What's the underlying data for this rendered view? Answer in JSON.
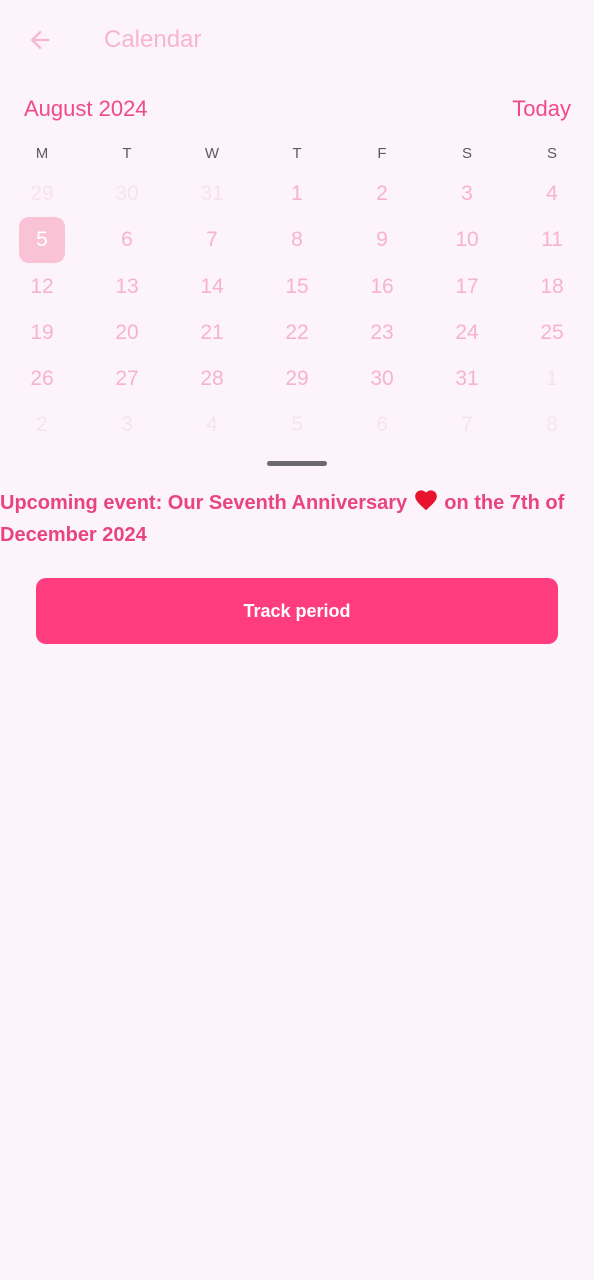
{
  "appbar": {
    "title": "Calendar",
    "back_icon": "arrow-left-icon"
  },
  "calendar": {
    "month_label": "August 2024",
    "today_label": "Today",
    "weekdays": [
      "M",
      "T",
      "W",
      "T",
      "F",
      "S",
      "S"
    ],
    "selected_day": "5",
    "weeks": [
      [
        {
          "d": "29",
          "out": true
        },
        {
          "d": "30",
          "out": true
        },
        {
          "d": "31",
          "out": true
        },
        {
          "d": "1",
          "out": false
        },
        {
          "d": "2",
          "out": false
        },
        {
          "d": "3",
          "out": false
        },
        {
          "d": "4",
          "out": false
        }
      ],
      [
        {
          "d": "5",
          "out": false
        },
        {
          "d": "6",
          "out": false
        },
        {
          "d": "7",
          "out": false
        },
        {
          "d": "8",
          "out": false
        },
        {
          "d": "9",
          "out": false
        },
        {
          "d": "10",
          "out": false
        },
        {
          "d": "11",
          "out": false
        }
      ],
      [
        {
          "d": "12",
          "out": false
        },
        {
          "d": "13",
          "out": false
        },
        {
          "d": "14",
          "out": false
        },
        {
          "d": "15",
          "out": false
        },
        {
          "d": "16",
          "out": false
        },
        {
          "d": "17",
          "out": false
        },
        {
          "d": "18",
          "out": false
        }
      ],
      [
        {
          "d": "19",
          "out": false
        },
        {
          "d": "20",
          "out": false
        },
        {
          "d": "21",
          "out": false
        },
        {
          "d": "22",
          "out": false
        },
        {
          "d": "23",
          "out": false
        },
        {
          "d": "24",
          "out": false
        },
        {
          "d": "25",
          "out": false
        }
      ],
      [
        {
          "d": "26",
          "out": false
        },
        {
          "d": "27",
          "out": false
        },
        {
          "d": "28",
          "out": false
        },
        {
          "d": "29",
          "out": false
        },
        {
          "d": "30",
          "out": false
        },
        {
          "d": "31",
          "out": false
        },
        {
          "d": "1",
          "out": true
        }
      ],
      [
        {
          "d": "2",
          "out": true
        },
        {
          "d": "3",
          "out": true
        },
        {
          "d": "4",
          "out": true
        },
        {
          "d": "5",
          "out": true
        },
        {
          "d": "6",
          "out": true
        },
        {
          "d": "7",
          "out": true
        },
        {
          "d": "8",
          "out": true
        }
      ]
    ]
  },
  "event": {
    "prefix": "Upcoming event: Our Seventh Anniversary ",
    "icon": "heart-icon",
    "suffix": " on the 7th of December 2024"
  },
  "actions": {
    "track_label": "Track period"
  },
  "colors": {
    "accent": "#ff3c7d",
    "text_pink": "#ef4a8a",
    "background": "#fdf3fb"
  }
}
